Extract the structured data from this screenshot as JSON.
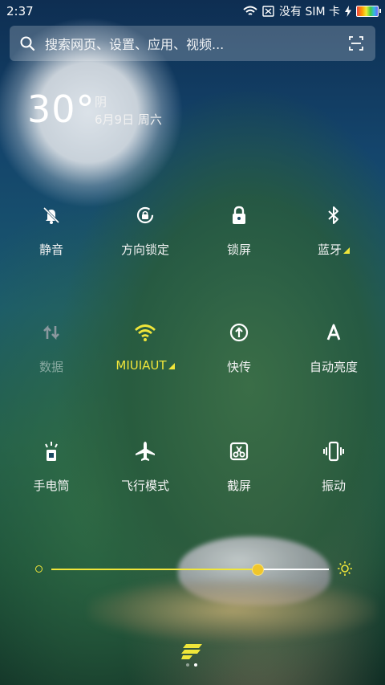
{
  "status_bar": {
    "time": "2:37",
    "carrier_text": "没有 SIM 卡",
    "icons": [
      "wifi-icon",
      "no-sim-icon",
      "charging-icon",
      "battery-icon"
    ]
  },
  "search": {
    "placeholder": "搜索网页、设置、应用、视频...",
    "icons": [
      "search-icon",
      "scan-icon"
    ]
  },
  "weather": {
    "temperature": "30°",
    "condition": "阴",
    "date": "6月9日 周六"
  },
  "toggles": [
    {
      "label": "静音",
      "icon": "mute-bell-icon",
      "state": "off"
    },
    {
      "label": "方向锁定",
      "icon": "rotation-lock-icon",
      "state": "off"
    },
    {
      "label": "锁屏",
      "icon": "lock-icon",
      "state": "off"
    },
    {
      "label": "蓝牙",
      "icon": "bluetooth-icon",
      "state": "off",
      "has_more": true
    },
    {
      "label": "数据",
      "icon": "mobile-data-icon",
      "state": "disabled"
    },
    {
      "label": "MIUIAUT",
      "icon": "wifi-icon",
      "state": "on",
      "has_more": true
    },
    {
      "label": "快传",
      "icon": "quick-transfer-icon",
      "state": "off"
    },
    {
      "label": "自动亮度",
      "icon": "auto-brightness-icon",
      "state": "off"
    },
    {
      "label": "手电筒",
      "icon": "flashlight-icon",
      "state": "off"
    },
    {
      "label": "飞行模式",
      "icon": "airplane-icon",
      "state": "off"
    },
    {
      "label": "截屏",
      "icon": "screenshot-icon",
      "state": "off"
    },
    {
      "label": "振动",
      "icon": "vibrate-icon",
      "state": "off"
    }
  ],
  "brightness": {
    "level": 0.74,
    "icons": [
      "brightness-low-icon",
      "brightness-high-icon"
    ]
  },
  "pager": {
    "pages": 2,
    "current": 2
  },
  "colors": {
    "accent": "#f0e63a",
    "text": "#ffffff",
    "disabled": "#7f8c92"
  }
}
